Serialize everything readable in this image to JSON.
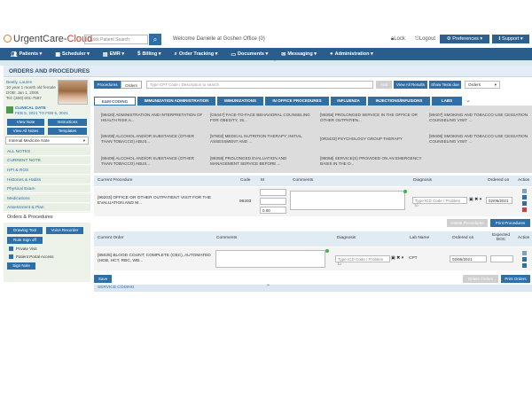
{
  "header": {
    "logo_main": "UrgentCare",
    "logo_sep": "-",
    "logo_accent": "Cloud",
    "search_placeholder": "Quick Patient Search",
    "welcome": "Welcome Danielle at Goshen Office (0)",
    "lock": "Lock",
    "logout": "Logout",
    "preferences": "Preferences",
    "support": "Support"
  },
  "nav": {
    "items": [
      {
        "label": "Patients",
        "icon": "users-icon"
      },
      {
        "label": "Scheduler",
        "icon": "calendar-icon"
      },
      {
        "label": "EMR",
        "icon": "document-icon"
      },
      {
        "label": "Billing",
        "icon": "dollar-icon"
      },
      {
        "label": "Order Tracking",
        "icon": "search-icon"
      },
      {
        "label": "Documents",
        "icon": "file-icon"
      },
      {
        "label": "Messaging",
        "icon": "envelope-icon"
      },
      {
        "label": "Administration",
        "icon": "person-icon"
      }
    ]
  },
  "page": {
    "title": "ORDERS AND PROCEDURES"
  },
  "patient": {
    "name": "Beetly, Lauren",
    "age": "10 year 1 month old female",
    "dob": "DOB: Jan 1, 2006",
    "tel": "Tel: (360) 601-7587",
    "clinical_label": "CLINICAL DATE",
    "clinical_date": "FEB 5, 2021 TO FEB 5, 2021"
  },
  "left": {
    "view_note": "View Note",
    "instructions": "Instructions",
    "view_all_notes": "View All Notes",
    "templates": "Templates",
    "note_select": "Internal Medicine Note",
    "items": [
      "ALL NOTES",
      "CURRENT NOTE",
      "HPI & ROS",
      "Histories & Habits",
      "Physical Exam",
      "Medications",
      "Assessment & Plan"
    ],
    "active_item": "Orders & Procedures",
    "drawing_tool": "Drawing Tool",
    "voice_recorder": "Voice Recorder",
    "rule_sign_off": "Rule Sign off",
    "private_visit": "Private Visit",
    "patient_portal": "Patient Portal Access",
    "sign_note": "Sign Note"
  },
  "toolbar": {
    "tab_procedures": "Procedures",
    "tab_orders": "Orders",
    "cpt_placeholder": "Type CPT Code / Description to search",
    "add": "Add",
    "view_all_results": "View All Results",
    "show_tests_due": "Show Tests due",
    "orders_select": "Orders"
  },
  "categories": [
    "E&M CODING",
    "IMMUNIZATION ADMINISTRATION",
    "IMMUNIZATIONS",
    "IN OFFICE PROCEDURES",
    "INFLUENZA",
    "INJECTIONS/INFUSIONS",
    "LABS"
  ],
  "grid": [
    [
      "[99420] ADMINISTRATION AND INTERPRETATION OF HEALTH RISK A...",
      "[G8447] FACE-TO-FACE BEHAVIORAL COUNSELING FOR OBESITY, 15...",
      "[99355] PROLONGED SERVICE IN THE OFFICE OR OTHER OUTPATIEN...",
      "[99407] SMOKING AND TOBACCO USE CESSATION COUNSELING VISIT ..."
    ],
    [
      "[99408] ALCOHOL AND/OR SUBSTANCE (OTHER THAN TOBACCO) ABUS...",
      "[97802] MEDICAL NUTRITION THERAPY; INITIAL ASSESSMENT AND ...",
      "[0R3433] PSYCHOLOGY GROUP THERAPY",
      "[99406] SMOKING AND TOBACCO USE CESSATION COUNSELING VISIT ..."
    ],
    [
      "[99409] ALCOHOL AND/OR SUBSTANCE (OTHER THAN TOBACCO) ABUS...",
      "[99358] PROLONGED EVALUATION AND MANAGEMENT SERVICE BEFORE ...",
      "[99058] SERVICE(S) PROVIDED ON AN EMERGENCY BASIS IN THE O...",
      ""
    ]
  ],
  "proc_table": {
    "headers": [
      "Current Procedure",
      "Code",
      "M",
      "Comments",
      "Diagnosis",
      "Ordered on",
      "Action"
    ],
    "row": {
      "procedure": "[99203] OFFICE OR OTHER OUTPATIENT VISIT FOR THE EVALUATION AND M...",
      "code": "99203",
      "units": "0.00",
      "diagnosis_placeholder": "Type ICD Code / Problem to",
      "ordered_on": "02/05/2021"
    },
    "delete": "Delete Procedures",
    "print": "Print Procedures"
  },
  "order_table": {
    "headers": [
      "Current Order",
      "Comments",
      "Diagnosis",
      "Lab Name",
      "Ordered on",
      "Expected DOC",
      "Action"
    ],
    "row": {
      "order": "[85025] BLOOD COUNT; COMPLETE (CBC), AUTOMATED (HGB, HCT, RBC, WB...",
      "diagnosis_placeholder": "Type ICD Code / Problem to",
      "lab": "CPT",
      "ordered_on": "02/05/2021"
    },
    "save": "Save",
    "delete": "Delete Orders",
    "print": "Print Orders"
  },
  "footer": {
    "service_coding": "SERVICE CODING"
  },
  "colors": {
    "brand_blue": "#2f6fa8",
    "nav_bg": "#2b5d8c",
    "accent_orange": "#e08020"
  }
}
